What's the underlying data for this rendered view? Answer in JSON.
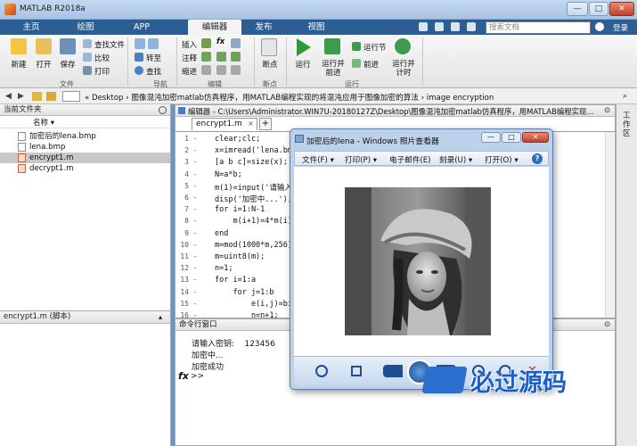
{
  "window": {
    "title": "MATLAB R2018a",
    "minimize": "—",
    "maximize": "□",
    "close": "✕"
  },
  "tabs": [
    "主页",
    "绘图",
    "APP",
    "编辑器",
    "发布",
    "视图"
  ],
  "search": {
    "placeholder": "搜索文档"
  },
  "ribbon": {
    "file": {
      "new": "新建",
      "open": "打开",
      "save": "保存",
      "find_files": "查找文件",
      "compare": "比较",
      "print": "打印",
      "group": "文件"
    },
    "nav": {
      "goto": "转至",
      "find": "查找",
      "group": "导航"
    },
    "edit": {
      "insert": "插入",
      "comment": "注释",
      "indent": "缩进",
      "fx": "fx",
      "group": "编辑"
    },
    "breakpoints": {
      "label": "断点",
      "group": "断点"
    },
    "run": {
      "run": "运行",
      "run_advance_1": "运行并",
      "run_advance_2": "前进",
      "run_section": "运行节",
      "advance": "前进",
      "run_time_1": "运行并",
      "run_time_2": "计时",
      "group": "运行"
    }
  },
  "address": {
    "path": "«  Desktop › 图像混沌加密matlab仿真程序，用MATLAB编程实现的将混沌应用于图像加密的算法 › image encryption"
  },
  "folder_panel": {
    "title": "当前文件夹",
    "column": "名称 ▾",
    "files": [
      "加密后的lena.bmp",
      "lena.bmp",
      "encrypt1.m",
      "decrypt1.m"
    ]
  },
  "details": {
    "title": "encrypt1.m  (脚本)"
  },
  "editor": {
    "header": "编辑器 - C:\\Users\\Administrator.WIN7U-20180127Z\\Desktop\\图像混沌加密matlab仿真程序，用MATLAB编程实现...",
    "tab": "encrypt1.m",
    "add_tab": "+",
    "lines": [
      {
        "n": "1",
        "code": "clear;clc;"
      },
      {
        "n": "2",
        "code": "x=imread('lena.bmp"
      },
      {
        "n": "3",
        "code": "[a b c]=size(x);"
      },
      {
        "n": "4",
        "code": "N=a*b;"
      },
      {
        "n": "5",
        "code": "m(1)=input('请输入"
      },
      {
        "n": "6",
        "code": "disp('加密中...');"
      },
      {
        "n": "7",
        "code": "for i=1:N-1"
      },
      {
        "n": "8",
        "code": "    m(i+1)=4*m(i)-"
      },
      {
        "n": "9",
        "code": "end"
      },
      {
        "n": "10",
        "code": "m=mod(1000*m,256)"
      },
      {
        "n": "11",
        "code": "m=uint8(m);"
      },
      {
        "n": "12",
        "code": "n=1;"
      },
      {
        "n": "13",
        "code": "for i=1:a"
      },
      {
        "n": "14",
        "code": "    for j=1:b"
      },
      {
        "n": "15",
        "code": "        e(i,j)=bit"
      },
      {
        "n": "16",
        "code": "        n=n+1;"
      }
    ]
  },
  "command_window": {
    "title": "命令行窗口",
    "lines": [
      "请输入密钥:    123456",
      "加密中...",
      "加密成功"
    ],
    "fx": "fx",
    "prompt": ">>"
  },
  "workspace_strip": {
    "label": "工作区"
  },
  "viewer": {
    "title": "加密后的lena - Windows 照片查看器",
    "menu": [
      "文件(F) ▾",
      "打印(P) ▾",
      "电子邮件(E)",
      "刻录(U) ▾",
      "打开(O) ▾"
    ],
    "help": "?"
  },
  "watermark": {
    "cn": "必过源码",
    "en": "Biguo100.com"
  },
  "colors": {
    "tabbar": "#2c5d93",
    "accent": "#f2a13a",
    "keyword": "#0000ff",
    "string": "#a020f0"
  }
}
